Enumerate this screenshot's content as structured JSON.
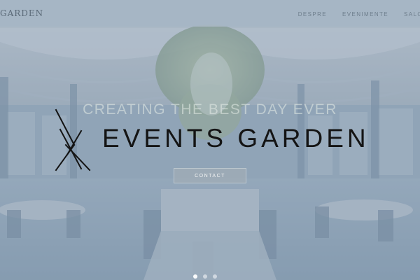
{
  "header": {
    "logo_text": "GARDEN",
    "nav_items": [
      "DESPRE",
      "EVENIMENTE",
      "SALO"
    ]
  },
  "hero": {
    "tagline": "CREATING THE BEST DAY EVER",
    "brand_name": "EVENTS GARDEN",
    "contact_label": "CONTACT"
  },
  "carousel": {
    "slides": 3,
    "active_index": 0
  },
  "colors": {
    "overlay": "#8fa3b2",
    "brand_text": "#141414",
    "nav_text": "#6f7f8d"
  }
}
